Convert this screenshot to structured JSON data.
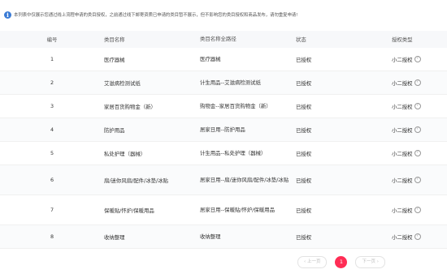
{
  "notice": {
    "icon": "info-icon",
    "text": "本列表中仅展示您通过线上流程申请的类目授权，之前通过线下邮寄资质已申请的类目暂不展示，但不影响您的类目授权和商品发布，请勿重复申请!"
  },
  "table": {
    "headers": [
      "编号",
      "类目名称",
      "类目名称全路径",
      "状态",
      "授权类型"
    ],
    "rows": [
      {
        "id": "1",
        "name": "医疗器械",
        "path": "医疗器械",
        "status": "已授权",
        "type": "小二授权"
      },
      {
        "id": "2",
        "name": "艾滋病检测试纸",
        "path": "计生用品--艾滋病检测试纸",
        "status": "已授权",
        "type": "小二授权"
      },
      {
        "id": "3",
        "name": "家居百货购物金（新）",
        "path": "购物金--家居百货购物金（新）",
        "status": "已授权",
        "type": "小二授权"
      },
      {
        "id": "4",
        "name": "防护用品",
        "path": "居家日用--防护用品",
        "status": "已授权",
        "type": "小二授权"
      },
      {
        "id": "5",
        "name": "私处护理（器械）",
        "path": "计生用品--私处护理（器械）",
        "status": "已授权",
        "type": "小二授权"
      },
      {
        "id": "6",
        "name": "扇/迷你风扇/配件/冰垫/冰贴",
        "path": "居家日用--扇/迷你风扇/配件/冰垫/冰贴",
        "status": "已授权",
        "type": "小二授权"
      },
      {
        "id": "7",
        "name": "保暖贴/怀炉/保暖用品",
        "path": "居家日用--保暖贴/怀炉/保暖用品",
        "status": "已授权",
        "type": "小二授权"
      },
      {
        "id": "8",
        "name": "收纳整理",
        "path": "收纳整理",
        "status": "已授权",
        "type": "小二授权"
      }
    ]
  },
  "pagination": {
    "prev_label": "‹ 上一页",
    "current_page": "1",
    "next_label": "下一页 ›"
  },
  "colors": {
    "accent": "#ff2d55",
    "info": "#3a7bd5",
    "header_bg": "#f7f8fa"
  }
}
